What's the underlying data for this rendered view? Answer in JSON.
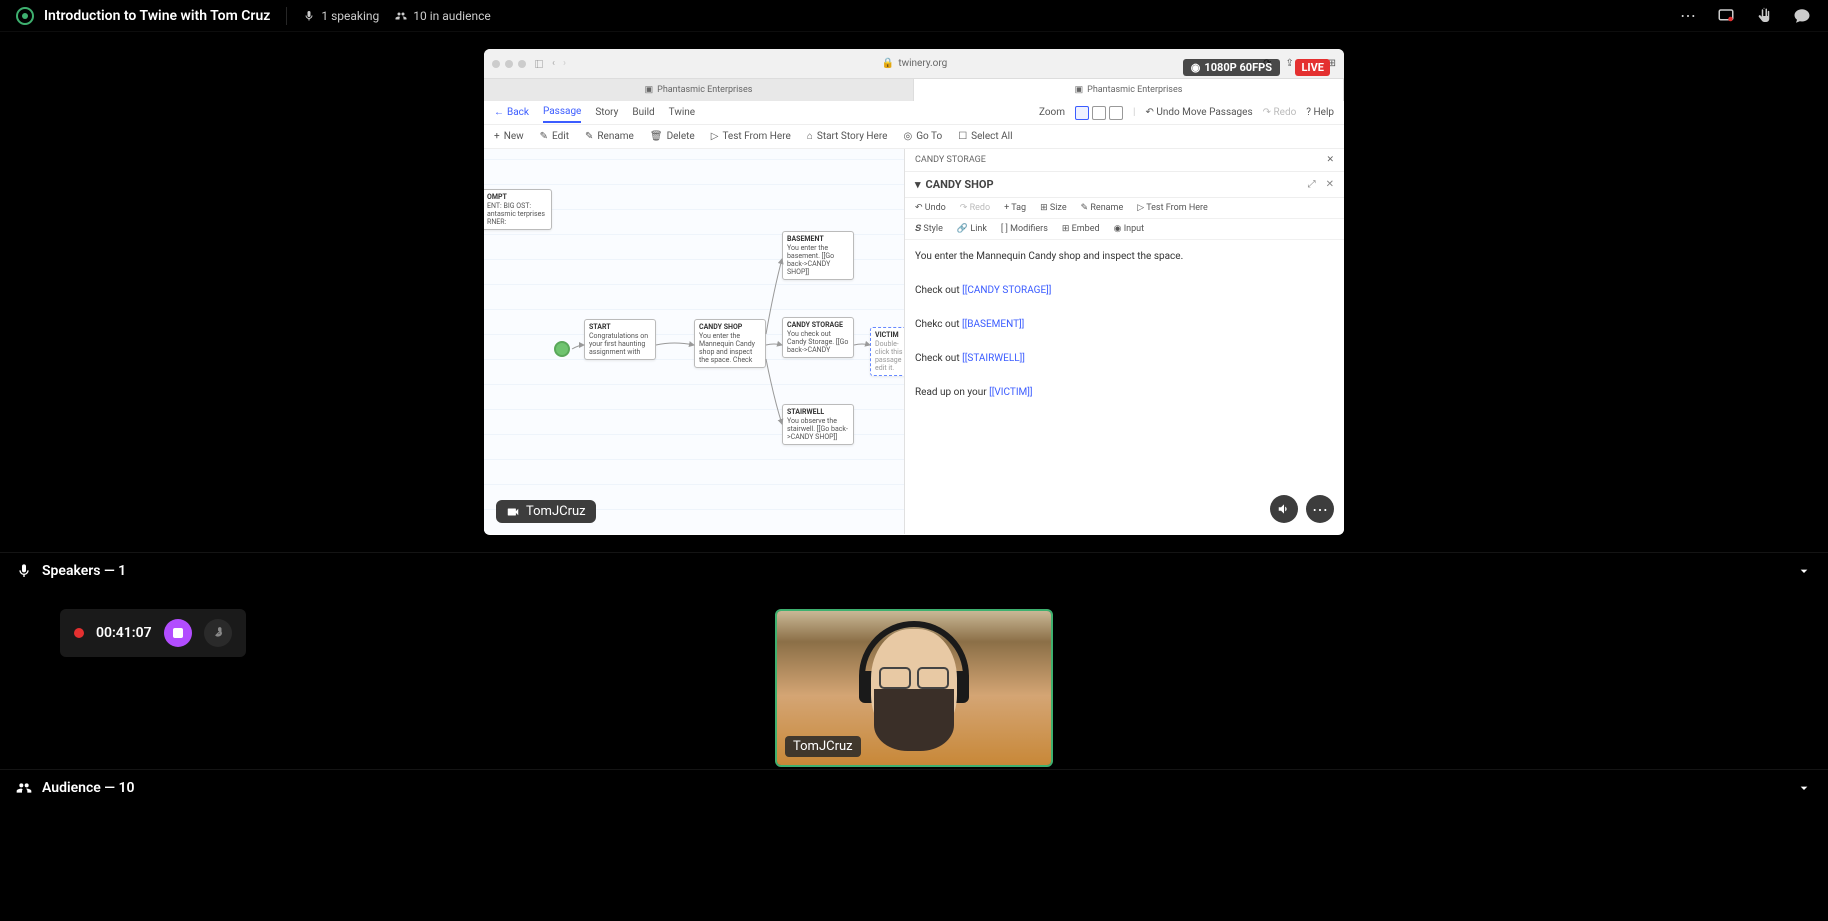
{
  "header": {
    "title": "Introduction to Twine with Tom Cruz",
    "speaking_count": "1 speaking",
    "audience_count": "10 in audience"
  },
  "stream": {
    "resolution": "1080P 60FPS",
    "live_label": "LIVE",
    "presenter": "TomJCruz"
  },
  "safari": {
    "url": "twinery.org",
    "tab1": "Phantasmic Enterprises",
    "tab2": "Phantasmic Enterprises"
  },
  "twine": {
    "back": "Back",
    "tabs": {
      "passage": "Passage",
      "story": "Story",
      "build": "Build",
      "twine": "Twine"
    },
    "zoom_label": "Zoom",
    "undo_move": "Undo Move Passages",
    "redo": "Redo",
    "help": "Help",
    "tools": {
      "new": "New",
      "edit": "Edit",
      "rename": "Rename",
      "delete": "Delete",
      "test_from_here": "Test From Here",
      "start_story_here": "Start Story Here",
      "go_to": "Go To",
      "select_all": "Select All"
    },
    "nodes": {
      "prompt": {
        "title": "OMPT",
        "body": "ENT: BIG\nOST:\nantasmic\nterprises\nRNER:"
      },
      "start": {
        "title": "START",
        "body": "Congratulations on your first haunting assignment with"
      },
      "candy_shop": {
        "title": "CANDY SHOP",
        "body": "You enter the Mannequin Candy shop and inspect the space. Check"
      },
      "basement": {
        "title": "BASEMENT",
        "body": "You enter the basement. [[Go back->CANDY SHOP]]"
      },
      "candy_storage": {
        "title": "CANDY STORAGE",
        "body": "You check out Candy Storage. [[Go back->CANDY"
      },
      "stairwell": {
        "title": "STAIRWELL",
        "body": "You observe the stairwell. [[Go back->CANDY SHOP]]"
      },
      "victim": {
        "title": "VICTIM",
        "body": "Double-click this passage edit it."
      }
    },
    "editor": {
      "crumb": "CANDY STORAGE",
      "title": "CANDY SHOP",
      "tools": {
        "undo": "Undo",
        "redo": "Redo",
        "tag": "Tag",
        "size": "Size",
        "rename": "Rename",
        "test": "Test From Here"
      },
      "format": {
        "style": "Style",
        "link": "Link",
        "modifiers": "Modifiers",
        "embed": "Embed",
        "input": "Input"
      },
      "lines": {
        "intro": "You enter the Mannequin Candy shop and inspect the space.",
        "l1a": "Check out ",
        "l1b": "[[CANDY STORAGE]]",
        "l2a": "Chekc out ",
        "l2b": "[[BASEMENT]]",
        "l3a": "Check out ",
        "l3b": "[[STAIRWELL]]",
        "l4a": "Read up on your ",
        "l4b": "[[VICTIM]]"
      }
    }
  },
  "sections": {
    "speakers": "Speakers — 1",
    "audience": "Audience — 10"
  },
  "recording": {
    "time": "00:41:07"
  },
  "speaker_tile": {
    "name": "TomJCruz"
  }
}
